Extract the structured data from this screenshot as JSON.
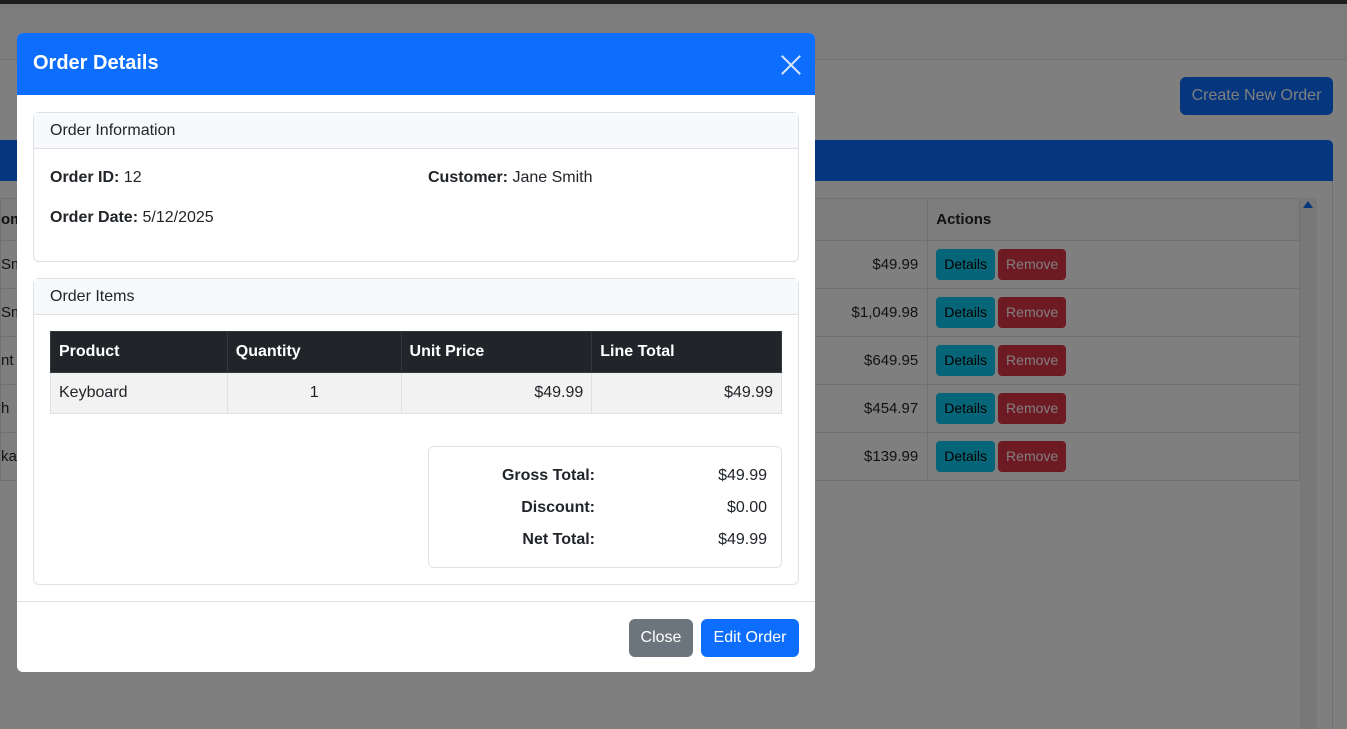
{
  "background": {
    "create_button": "Create New Order",
    "actions_header": "Actions",
    "customer_header_fragment": "om",
    "details_label": "Details",
    "remove_label": "Remove",
    "rows": [
      {
        "customer_fragment": "Sm",
        "total": "$49.99"
      },
      {
        "customer_fragment": "Sm",
        "total": "$1,049.98"
      },
      {
        "customer_fragment": "nt",
        "total": "$649.95"
      },
      {
        "customer_fragment": "h",
        "total": "$454.97"
      },
      {
        "customer_fragment": "ka",
        "total": "$139.99"
      }
    ]
  },
  "modal": {
    "title": "Order Details",
    "info": {
      "header": "Order Information",
      "order_id_label": "Order ID:",
      "order_id": "12",
      "customer_label": "Customer:",
      "customer": "Jane Smith",
      "order_date_label": "Order Date:",
      "order_date": "5/12/2025"
    },
    "items": {
      "header": "Order Items",
      "columns": [
        "Product",
        "Quantity",
        "Unit Price",
        "Line Total"
      ],
      "rows": [
        {
          "product": "Keyboard",
          "quantity": "1",
          "unit_price": "$49.99",
          "line_total": "$49.99"
        }
      ]
    },
    "totals": {
      "gross_label": "Gross Total:",
      "gross": "$49.99",
      "discount_label": "Discount:",
      "discount": "$0.00",
      "net_label": "Net Total:",
      "net": "$49.99"
    },
    "footer": {
      "close_label": "Close",
      "edit_label": "Edit Order"
    }
  },
  "colors": {
    "primary": "#0d6efd",
    "secondary": "#6c757d",
    "info": "#0dcaf0",
    "danger": "#dc3545",
    "dark": "#212529"
  }
}
